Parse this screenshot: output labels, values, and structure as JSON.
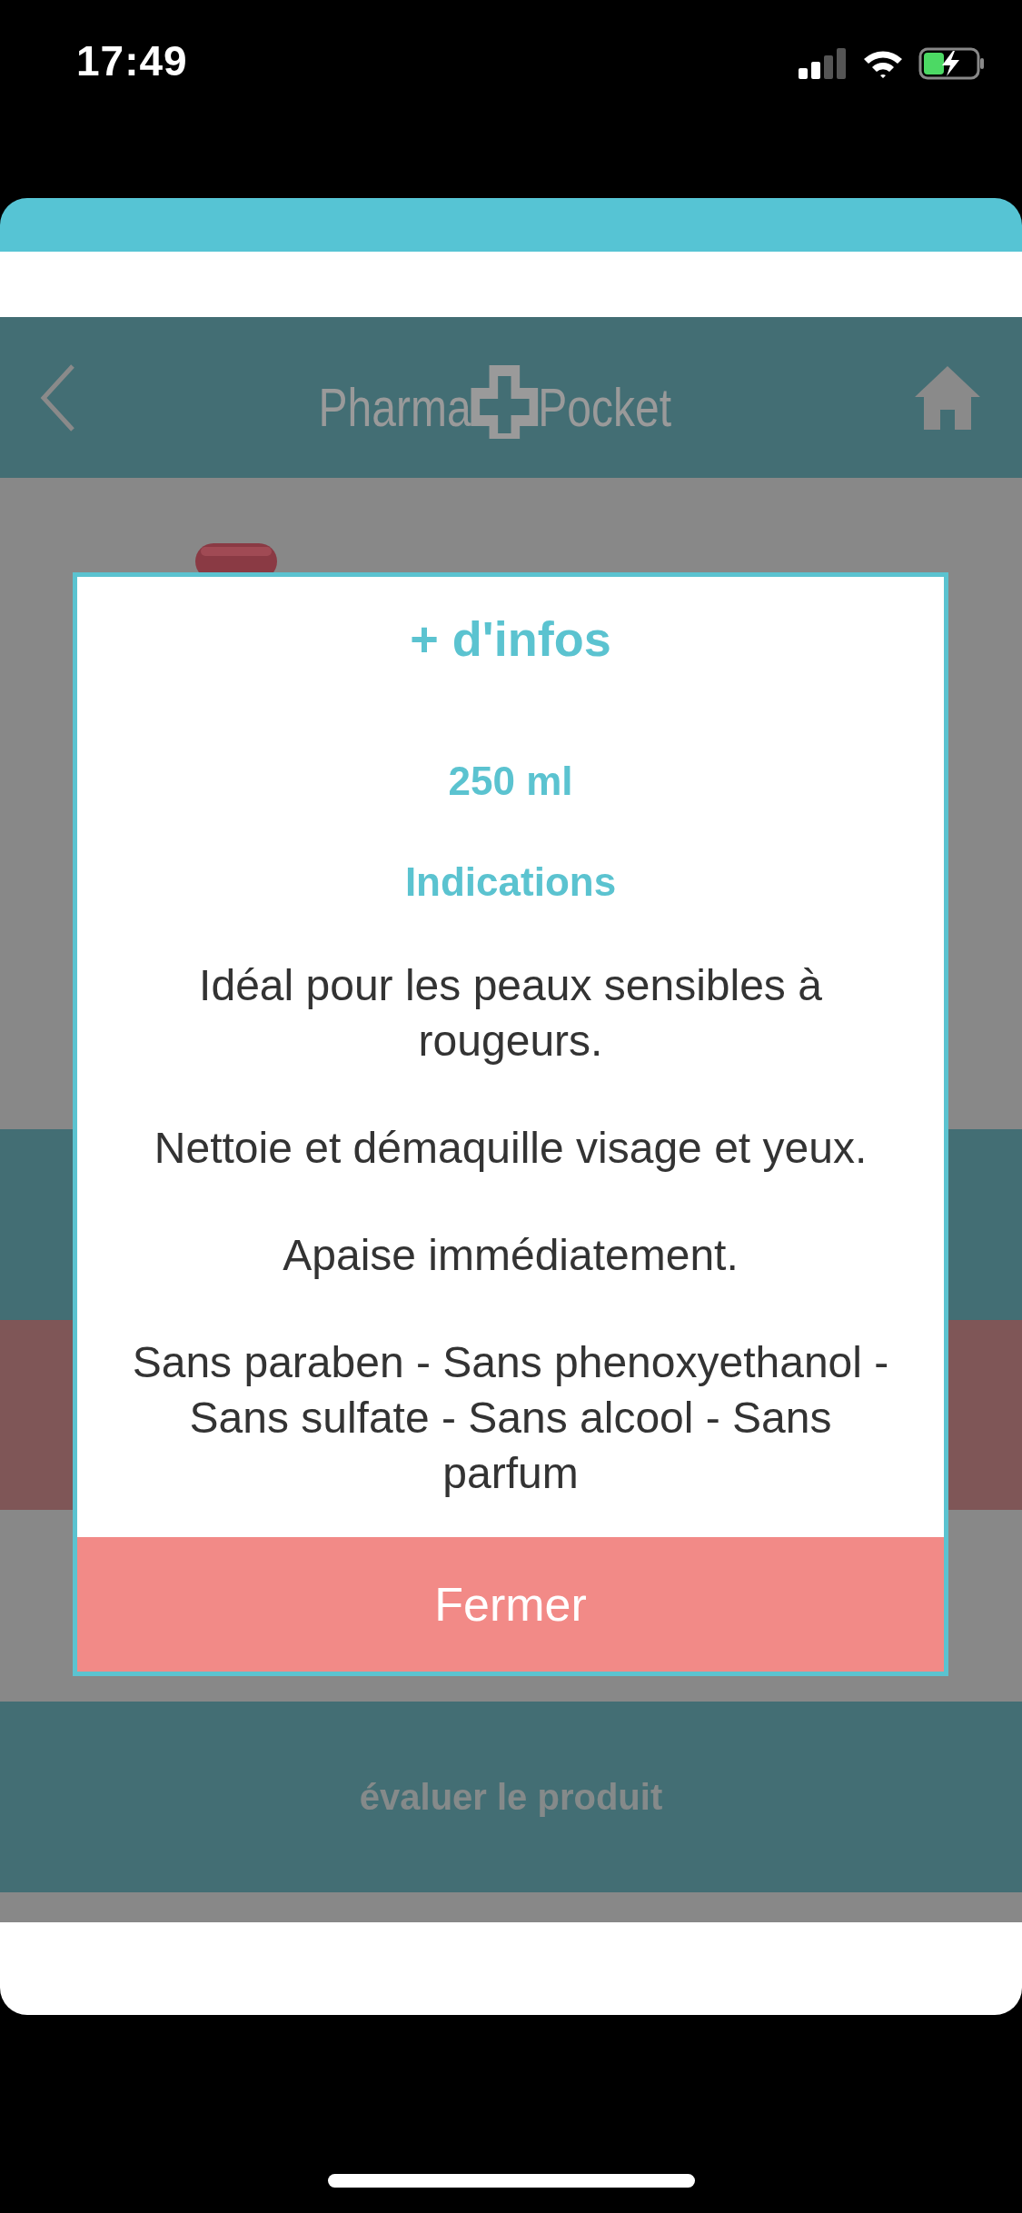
{
  "status_bar": {
    "time": "17:49"
  },
  "header": {
    "logo": [
      "Pharma",
      "Pocket"
    ]
  },
  "rate_button": {
    "label": "évaluer le produit"
  },
  "dialog": {
    "title": "+ d'infos",
    "size": "250 ml",
    "section_title": "Indications",
    "paragraphs": [
      "Idéal pour les peaux sensibles à rougeurs.",
      "Nettoie et démaquille visage et yeux.",
      "Apaise immédiatement.",
      "Sans paraben - Sans phenoxyethanol - Sans sulfate - Sans alcool - Sans parfum"
    ],
    "close_button": "Fermer"
  }
}
